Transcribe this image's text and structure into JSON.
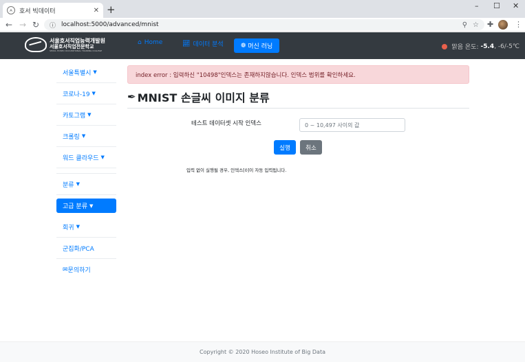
{
  "browser": {
    "tab_title": "호서 빅데이터",
    "tab_icon": "hoseo-favicon-icon",
    "url": "localhost:5000/advanced/mnist",
    "minimize": "–",
    "maximize": "☐",
    "close": "✕"
  },
  "navbar": {
    "brand_line1": "서울호서직업능력개발원",
    "brand_line2": "서울호서직업전문학교",
    "brand_line3": "SEOUL HOSEO OCCUPATIONAL TRAINING COLLEGE",
    "links": [
      {
        "label": "Home",
        "icon": "home-icon"
      },
      {
        "label": "데이터 분석",
        "icon": "chart-line-icon"
      },
      {
        "label": "머신 러닝",
        "icon": "brain-icon",
        "active": true
      }
    ],
    "weather_label": "맑음 온도:",
    "weather_temp": "-5.4",
    "weather_range": ", -6/-5℃"
  },
  "sidebar": {
    "items": [
      {
        "label": "서울특별시",
        "caret": true
      },
      {
        "label": "코로나-19",
        "caret": true
      },
      {
        "label": "카토그램",
        "caret": true
      },
      {
        "label": "크롤링",
        "caret": true
      },
      {
        "label": "워드 클라우드",
        "caret": true
      },
      {
        "label": "분류",
        "caret": true
      },
      {
        "label": "고급 분류",
        "caret": true,
        "active": true
      },
      {
        "label": "회귀",
        "caret": true
      },
      {
        "label": "군집화/PCA",
        "caret": false
      },
      {
        "label": "문의하기",
        "caret": false,
        "icon": "envelope-icon"
      }
    ]
  },
  "main": {
    "alert": "index error : 입력하신 \"10498\"인덱스는 존재하지않습니다. 인덱스 범위를 확인하세요.",
    "title": "MNIST 손글씨 이미지 분류",
    "field_label": "테스트 데이터셋 시작 인덱스",
    "field_placeholder": "0 ~ 10,497 사이의 값",
    "run_label": "실행",
    "cancel_label": "취소",
    "hint": "입력 없이 실행될 경우, 인덱스[0]이 자동 입력됩니다."
  },
  "footer": {
    "text": "Copyright © 2020 Hoseo Institute of Big Data"
  },
  "colors": {
    "primary": "#007bff",
    "navbar_bg": "#343a40",
    "alert_bg": "#f8d7da",
    "alert_text": "#721c24",
    "secondary": "#6c757d"
  }
}
